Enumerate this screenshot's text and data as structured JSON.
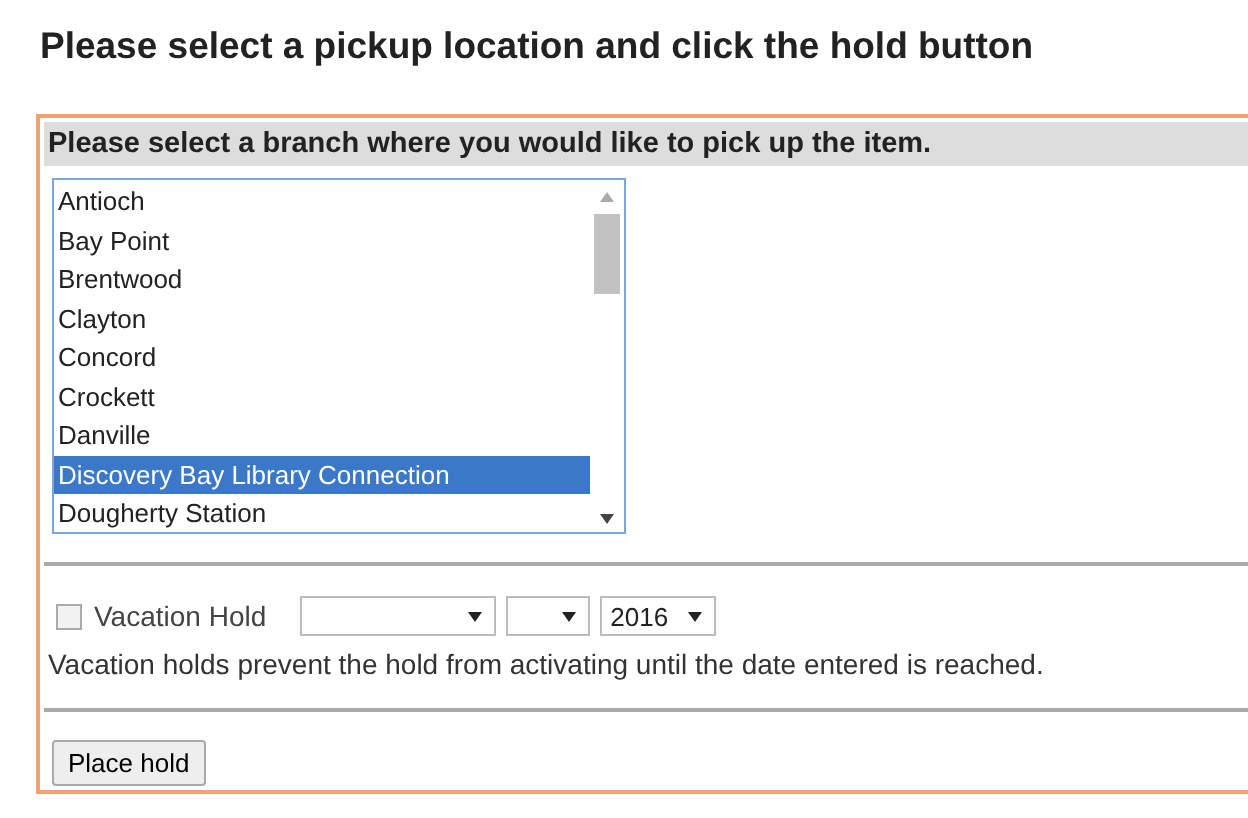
{
  "heading": "Please select a pickup location and click the hold button",
  "panel": {
    "title": "Please select a branch where you would like to pick up the item.",
    "branches": [
      {
        "label": "Antioch",
        "selected": false
      },
      {
        "label": "Bay Point",
        "selected": false
      },
      {
        "label": "Brentwood",
        "selected": false
      },
      {
        "label": "Clayton",
        "selected": false
      },
      {
        "label": "Concord",
        "selected": false
      },
      {
        "label": "Crockett",
        "selected": false
      },
      {
        "label": "Danville",
        "selected": false
      },
      {
        "label": "Discovery Bay Library Connection",
        "selected": true
      },
      {
        "label": "Dougherty Station",
        "selected": false
      }
    ],
    "vacation_hold": {
      "label": "Vacation Hold",
      "checked": false,
      "year": "2016",
      "note": "Vacation holds prevent the hold from activating until the date entered is reached."
    },
    "button": "Place hold"
  }
}
